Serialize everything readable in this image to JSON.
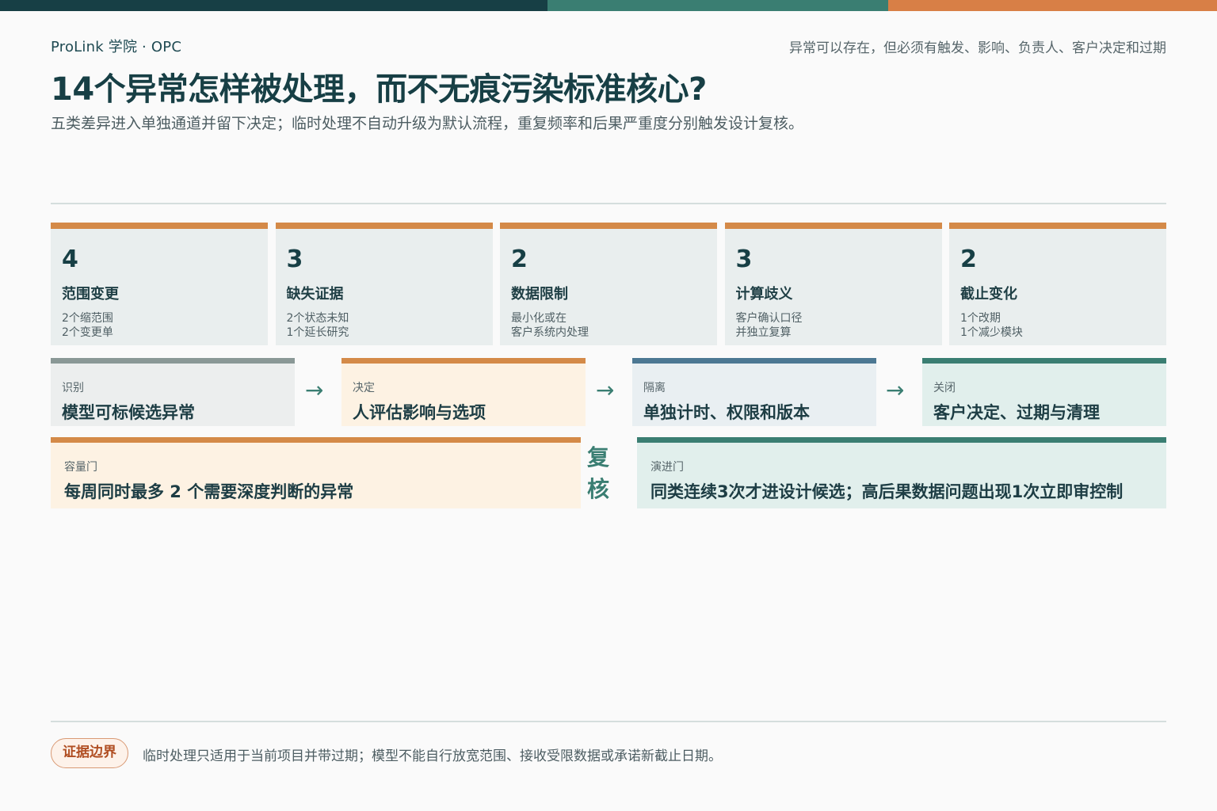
{
  "header": {
    "brand": "ProLink 学院 · OPC",
    "tagline": "异常可以存在，但必须有触发、影响、负责人、客户决定和过期",
    "title": "14个异常怎样被处理，而不无痕污染标准核心?",
    "subtitle": "五类差异进入单独通道并留下决定；临时处理不自动升级为默认流程，重复频率和后果严重度分别触发设计复核。"
  },
  "colors": {
    "dark_teal": "#173f45",
    "teal": "#3a7e72",
    "orange": "#d87f46",
    "slate_blue": "#4c7893"
  },
  "categories": [
    {
      "count": "4",
      "name": "范围变更",
      "lines": [
        "2个缩范围",
        "2个变更单"
      ]
    },
    {
      "count": "3",
      "name": "缺失证据",
      "lines": [
        "2个状态未知",
        "1个延长研究"
      ]
    },
    {
      "count": "2",
      "name": "数据限制",
      "lines": [
        "最小化或在",
        "客户系统内处理"
      ]
    },
    {
      "count": "3",
      "name": "计算歧义",
      "lines": [
        "客户确认口径",
        "并独立复算"
      ]
    },
    {
      "count": "2",
      "name": "截止变化",
      "lines": [
        "1个改期",
        "1个减少模块"
      ]
    }
  ],
  "flow": [
    {
      "label": "识别",
      "value": "模型可标候选异常"
    },
    {
      "label": "决定",
      "value": "人评估影响与选项"
    },
    {
      "label": "隔离",
      "value": "单独计时、权限和版本"
    },
    {
      "label": "关闭",
      "value": "客户决定、过期与清理"
    }
  ],
  "arrow_glyph": "→",
  "gates": {
    "capacity": {
      "label": "容量门",
      "value": "每周同时最多 2 个需要深度判断的异常"
    },
    "review_chars": [
      "复",
      "核"
    ],
    "evolution": {
      "label": "演进门",
      "value": "同类连续3次才进设计候选；高后果数据问题出现1次立即审控制"
    }
  },
  "footer": {
    "badge": "证据边界",
    "note": "临时处理只适用于当前项目并带过期；模型不能自行放宽范围、接收受限数据或承诺新截止日期。"
  }
}
